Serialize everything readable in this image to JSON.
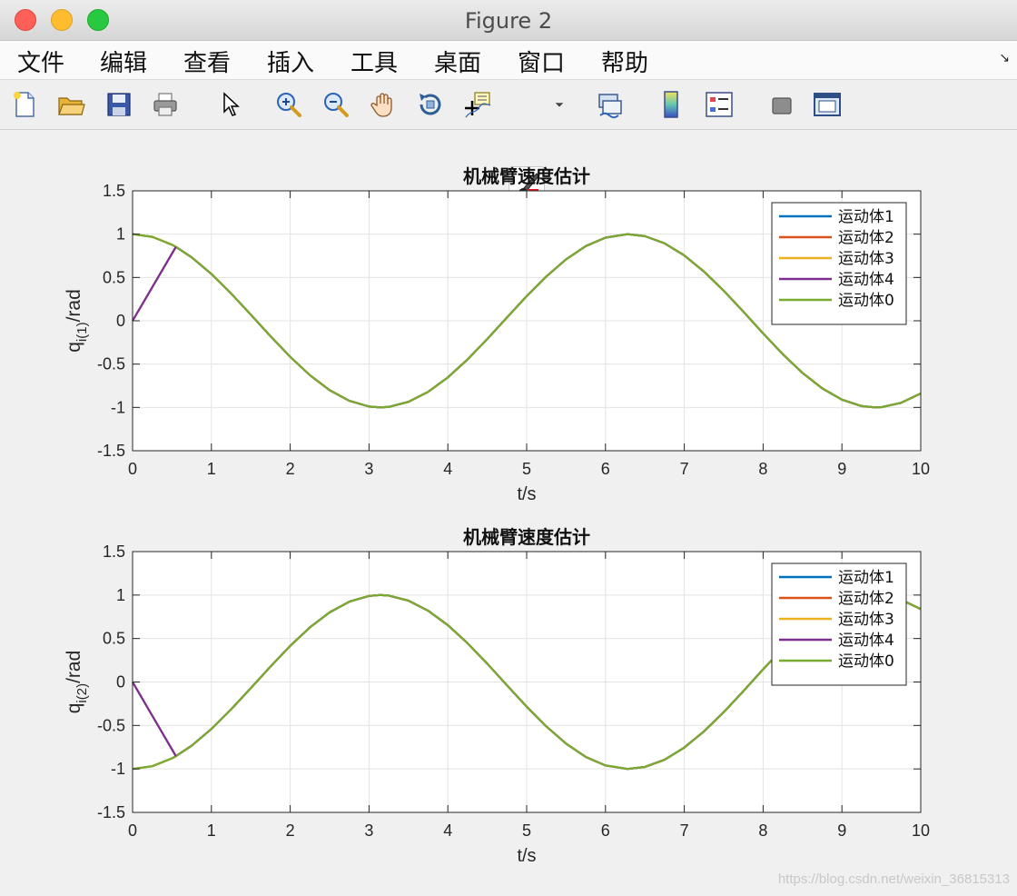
{
  "window": {
    "title": "Figure 2",
    "menu": [
      "文件",
      "编辑",
      "查看",
      "插入",
      "工具",
      "桌面",
      "窗口",
      "帮助"
    ],
    "menu_arrow": "↘"
  },
  "toolbar": {
    "icons": [
      "new-figure-icon",
      "open-file-icon",
      "save-icon",
      "print-icon",
      "pointer-icon",
      "zoom-in-icon",
      "zoom-out-icon",
      "pan-hand-icon",
      "rotate-3d-icon",
      "data-cursor-icon",
      "brush-icon",
      "brush-dropdown-icon",
      "link-plot-icon",
      "colorbar-icon",
      "legend-icon",
      "hide-plot-tools-icon",
      "show-plot-tools-icon"
    ]
  },
  "watermark": "https://blog.csdn.net/weixin_36815313",
  "chart_data": [
    {
      "type": "line",
      "title": "机械臂速度估计",
      "xlabel": "t/s",
      "ylabel_main": "q",
      "ylabel_sub": "i(1)",
      "ylabel_suffix": "/rad",
      "xlim": [
        0,
        10
      ],
      "ylim": [
        -1.5,
        1.5
      ],
      "xticks": [
        0,
        1,
        2,
        3,
        4,
        5,
        6,
        7,
        8,
        9,
        10
      ],
      "yticks": [
        -1.5,
        -1,
        -0.5,
        0,
        0.5,
        1,
        1.5
      ],
      "ytick_labels": [
        "-1.5",
        "-1",
        "-0.5",
        "0",
        "0.5",
        "1",
        "1.5"
      ],
      "grid": true,
      "legend_position": "top-right",
      "x": [
        0,
        0.25,
        0.5,
        0.55,
        0.75,
        1,
        1.25,
        1.5,
        1.75,
        2,
        2.25,
        2.5,
        2.75,
        3,
        3.14,
        3.25,
        3.5,
        3.75,
        4,
        4.25,
        4.5,
        4.75,
        5,
        5.25,
        5.5,
        5.75,
        6,
        6.28,
        6.5,
        6.75,
        7,
        7.25,
        7.5,
        7.75,
        8,
        8.25,
        8.5,
        8.75,
        9,
        9.25,
        9.42,
        9.5,
        9.75,
        10
      ],
      "series": [
        {
          "name": "运动体1",
          "color": "#0072bd",
          "values": [
            1,
            0.969,
            0.878,
            0.853,
            0.732,
            0.54,
            0.315,
            0.071,
            -0.178,
            -0.416,
            -0.628,
            -0.801,
            -0.924,
            -0.99,
            -1.0,
            -0.994,
            -0.936,
            -0.82,
            -0.654,
            -0.446,
            -0.211,
            0.038,
            0.284,
            0.512,
            0.709,
            0.862,
            0.96,
            1.0,
            0.977,
            0.894,
            0.754,
            0.568,
            0.347,
            0.105,
            -0.146,
            -0.386,
            -0.602,
            -0.78,
            -0.911,
            -0.985,
            -1.0,
            -0.997,
            -0.947,
            -0.839
          ]
        },
        {
          "name": "运动体2",
          "color": "#d95319",
          "values": [
            1,
            0.969,
            0.878,
            0.853,
            0.732,
            0.54,
            0.315,
            0.071,
            -0.178,
            -0.416,
            -0.628,
            -0.801,
            -0.924,
            -0.99,
            -1.0,
            -0.994,
            -0.936,
            -0.82,
            -0.654,
            -0.446,
            -0.211,
            0.038,
            0.284,
            0.512,
            0.709,
            0.862,
            0.96,
            1.0,
            0.977,
            0.894,
            0.754,
            0.568,
            0.347,
            0.105,
            -0.146,
            -0.386,
            -0.602,
            -0.78,
            -0.911,
            -0.985,
            -1.0,
            -0.997,
            -0.947,
            -0.839
          ]
        },
        {
          "name": "运动体3",
          "color": "#edb120",
          "values": [
            1,
            0.969,
            0.878,
            0.853,
            0.732,
            0.54,
            0.315,
            0.071,
            -0.178,
            -0.416,
            -0.628,
            -0.801,
            -0.924,
            -0.99,
            -1.0,
            -0.994,
            -0.936,
            -0.82,
            -0.654,
            -0.446,
            -0.211,
            0.038,
            0.284,
            0.512,
            0.709,
            0.862,
            0.96,
            1.0,
            0.977,
            0.894,
            0.754,
            0.568,
            0.347,
            0.105,
            -0.146,
            -0.386,
            -0.602,
            -0.78,
            -0.911,
            -0.985,
            -1.0,
            -0.997,
            -0.947,
            -0.839
          ]
        },
        {
          "name": "运动体4",
          "color": "#7e2f8e",
          "values": [
            0,
            0.388,
            0.776,
            0.853,
            0.732,
            0.54,
            0.315,
            0.071,
            -0.178,
            -0.416,
            -0.628,
            -0.801,
            -0.924,
            -0.99,
            -1.0,
            -0.994,
            -0.936,
            -0.82,
            -0.654,
            -0.446,
            -0.211,
            0.038,
            0.284,
            0.512,
            0.709,
            0.862,
            0.96,
            1.0,
            0.977,
            0.894,
            0.754,
            0.568,
            0.347,
            0.105,
            -0.146,
            -0.386,
            -0.602,
            -0.78,
            -0.911,
            -0.985,
            -1.0,
            -0.997,
            -0.947,
            -0.839
          ]
        },
        {
          "name": "运动体0",
          "color": "#77ac30",
          "values": [
            1,
            0.969,
            0.878,
            0.853,
            0.732,
            0.54,
            0.315,
            0.071,
            -0.178,
            -0.416,
            -0.628,
            -0.801,
            -0.924,
            -0.99,
            -1.0,
            -0.994,
            -0.936,
            -0.82,
            -0.654,
            -0.446,
            -0.211,
            0.038,
            0.284,
            0.512,
            0.709,
            0.862,
            0.96,
            1.0,
            0.977,
            0.894,
            0.754,
            0.568,
            0.347,
            0.105,
            -0.146,
            -0.386,
            -0.602,
            -0.78,
            -0.911,
            -0.985,
            -1.0,
            -0.997,
            -0.947,
            -0.839
          ]
        }
      ]
    },
    {
      "type": "line",
      "title": "机械臂速度估计",
      "xlabel": "t/s",
      "ylabel_main": "q",
      "ylabel_sub": "i(2)",
      "ylabel_suffix": "/rad",
      "xlim": [
        0,
        10
      ],
      "ylim": [
        -1.5,
        1.5
      ],
      "xticks": [
        0,
        1,
        2,
        3,
        4,
        5,
        6,
        7,
        8,
        9,
        10
      ],
      "yticks": [
        -1.5,
        -1,
        -0.5,
        0,
        0.5,
        1,
        1.5
      ],
      "ytick_labels": [
        "-1.5",
        "-1",
        "-0.5",
        "0",
        "0.5",
        "1",
        "1.5"
      ],
      "grid": true,
      "legend_position": "top-right",
      "x": [
        0,
        0.25,
        0.5,
        0.55,
        0.75,
        1,
        1.25,
        1.5,
        1.75,
        2,
        2.25,
        2.5,
        2.75,
        3,
        3.14,
        3.25,
        3.5,
        3.75,
        4,
        4.25,
        4.5,
        4.75,
        5,
        5.25,
        5.5,
        5.75,
        6,
        6.28,
        6.5,
        6.75,
        7,
        7.25,
        7.5,
        7.75,
        8,
        8.25,
        8.5,
        8.75,
        9,
        9.25,
        9.42,
        9.5,
        9.75,
        10
      ],
      "series": [
        {
          "name": "运动体1",
          "color": "#0072bd",
          "values": [
            -1,
            -0.969,
            -0.878,
            -0.853,
            -0.732,
            -0.54,
            -0.315,
            -0.071,
            0.178,
            0.416,
            0.628,
            0.801,
            0.924,
            0.99,
            1.0,
            0.994,
            0.936,
            0.82,
            0.654,
            0.446,
            0.211,
            -0.038,
            -0.284,
            -0.512,
            -0.709,
            -0.862,
            -0.96,
            -1.0,
            -0.977,
            -0.894,
            -0.754,
            -0.568,
            -0.347,
            -0.105,
            0.146,
            0.386,
            0.602,
            0.78,
            0.911,
            0.985,
            1.0,
            0.997,
            0.947,
            0.839
          ]
        },
        {
          "name": "运动体2",
          "color": "#d95319",
          "values": [
            -1,
            -0.969,
            -0.878,
            -0.853,
            -0.732,
            -0.54,
            -0.315,
            -0.071,
            0.178,
            0.416,
            0.628,
            0.801,
            0.924,
            0.99,
            1.0,
            0.994,
            0.936,
            0.82,
            0.654,
            0.446,
            0.211,
            -0.038,
            -0.284,
            -0.512,
            -0.709,
            -0.862,
            -0.96,
            -1.0,
            -0.977,
            -0.894,
            -0.754,
            -0.568,
            -0.347,
            -0.105,
            0.146,
            0.386,
            0.602,
            0.78,
            0.911,
            0.985,
            1.0,
            0.997,
            0.947,
            0.839
          ]
        },
        {
          "name": "运动体3",
          "color": "#edb120",
          "values": [
            -1,
            -0.969,
            -0.878,
            -0.853,
            -0.732,
            -0.54,
            -0.315,
            -0.071,
            0.178,
            0.416,
            0.628,
            0.801,
            0.924,
            0.99,
            1.0,
            0.994,
            0.936,
            0.82,
            0.654,
            0.446,
            0.211,
            -0.038,
            -0.284,
            -0.512,
            -0.709,
            -0.862,
            -0.96,
            -1.0,
            -0.977,
            -0.894,
            -0.754,
            -0.568,
            -0.347,
            -0.105,
            0.146,
            0.386,
            0.602,
            0.78,
            0.911,
            0.985,
            1.0,
            0.997,
            0.947,
            0.839
          ]
        },
        {
          "name": "运动体4",
          "color": "#7e2f8e",
          "values": [
            0,
            -0.388,
            -0.776,
            -0.853,
            -0.732,
            -0.54,
            -0.315,
            -0.071,
            0.178,
            0.416,
            0.628,
            0.801,
            0.924,
            0.99,
            1.0,
            0.994,
            0.936,
            0.82,
            0.654,
            0.446,
            0.211,
            -0.038,
            -0.284,
            -0.512,
            -0.709,
            -0.862,
            -0.96,
            -1.0,
            -0.977,
            -0.894,
            -0.754,
            -0.568,
            -0.347,
            -0.105,
            0.146,
            0.386,
            0.602,
            0.78,
            0.911,
            0.985,
            1.0,
            0.997,
            0.947,
            0.839
          ]
        },
        {
          "name": "运动体0",
          "color": "#77ac30",
          "values": [
            -1,
            -0.969,
            -0.878,
            -0.853,
            -0.732,
            -0.54,
            -0.315,
            -0.071,
            0.178,
            0.416,
            0.628,
            0.801,
            0.924,
            0.99,
            1.0,
            0.994,
            0.936,
            0.82,
            0.654,
            0.446,
            0.211,
            -0.038,
            -0.284,
            -0.512,
            -0.709,
            -0.862,
            -0.96,
            -1.0,
            -0.977,
            -0.894,
            -0.754,
            -0.568,
            -0.347,
            -0.105,
            0.146,
            0.386,
            0.602,
            0.78,
            0.911,
            0.985,
            1.0,
            0.997,
            0.947,
            0.839
          ]
        }
      ]
    }
  ]
}
